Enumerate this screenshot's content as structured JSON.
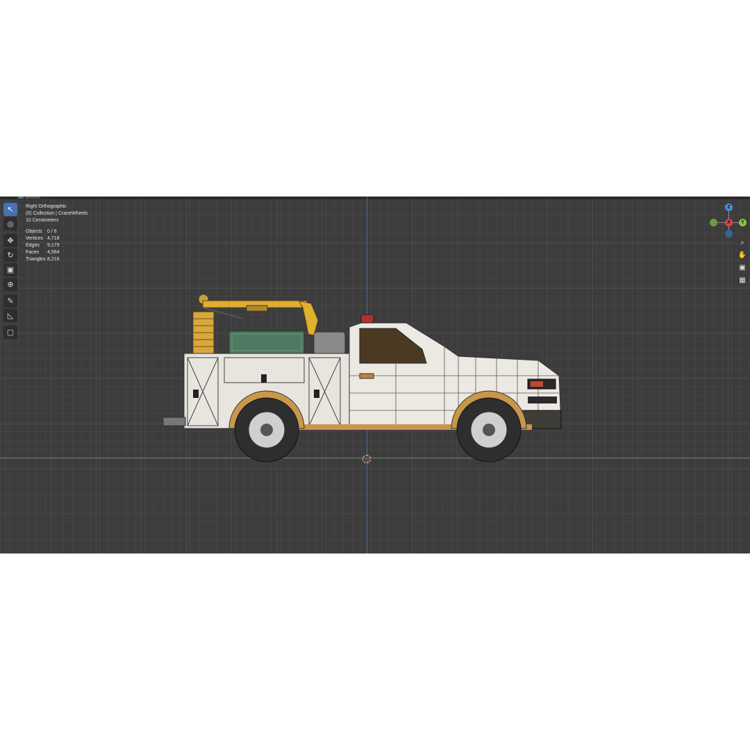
{
  "viewport": {
    "view_name": "Right Orthographic",
    "collection": "(0) Collection | CraneWheels",
    "scale": "10 Centimeters",
    "stats": [
      {
        "label": "Objects",
        "value": "0 / 6"
      },
      {
        "label": "Vertices",
        "value": "4,718"
      },
      {
        "label": "Edges",
        "value": "9,179"
      },
      {
        "label": "Faces",
        "value": "4,564"
      },
      {
        "label": "Triangles",
        "value": "8,216"
      }
    ]
  },
  "toolbar": {
    "tools": [
      "select-box",
      "cursor",
      "move",
      "rotate",
      "scale",
      "transform",
      "annotate",
      "measure",
      "add-cube"
    ],
    "active": "select-box"
  },
  "gizmo": {
    "labels": {
      "z": "Z",
      "y": "Y",
      "x": "X"
    },
    "colors": {
      "x": "#e0404f",
      "y": "#8bc34a",
      "z": "#4a8fdc"
    }
  },
  "navigation": [
    "zoom-icon",
    "pan-icon",
    "camera-icon",
    "grid-icon"
  ],
  "colors": {
    "viewport_bg": "#3c3c3c",
    "active_tool": "#4772b3",
    "axis_x_line": "#6f8a36",
    "axis_z_line": "#3e6fa6"
  }
}
